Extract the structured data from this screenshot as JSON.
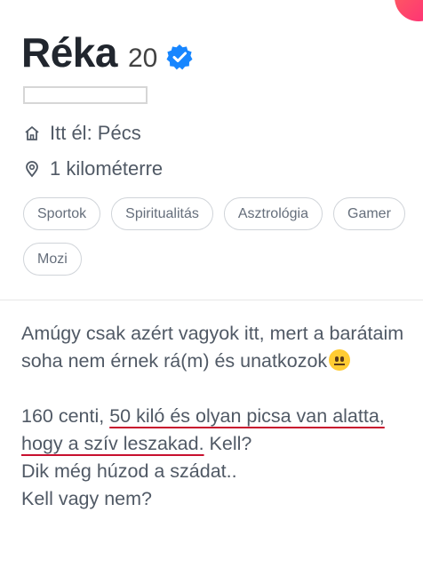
{
  "profile": {
    "name": "Réka",
    "age": "20",
    "lives_in": "Itt él: Pécs",
    "distance": "1 kilométerre"
  },
  "interests": [
    "Sportok",
    "Spiritualitás",
    "Asztrológia",
    "Gamer",
    "Mozi"
  ],
  "bio": {
    "line1_a": "Amúgy csak azért vagyok itt, mert a barátaim soha nem érnek rá(m) és unatkozok",
    "emoji": "neutral-face-emoji",
    "line2_a": "160 centi, ",
    "line2_underlined": "50 kiló és olyan picsa van alatta, hogy a szív leszakad.",
    "line2_b": " Kell?",
    "line3": "Dik még húzod a szádat..",
    "line4": "Kell vagy nem?"
  },
  "colors": {
    "verified": "#1786ff",
    "underline": "#c8102e",
    "brand_gradient_start": "#ff655b",
    "brand_gradient_end": "#fd297b"
  },
  "icons": [
    "verified-badge-icon",
    "home-icon",
    "location-pin-icon"
  ]
}
